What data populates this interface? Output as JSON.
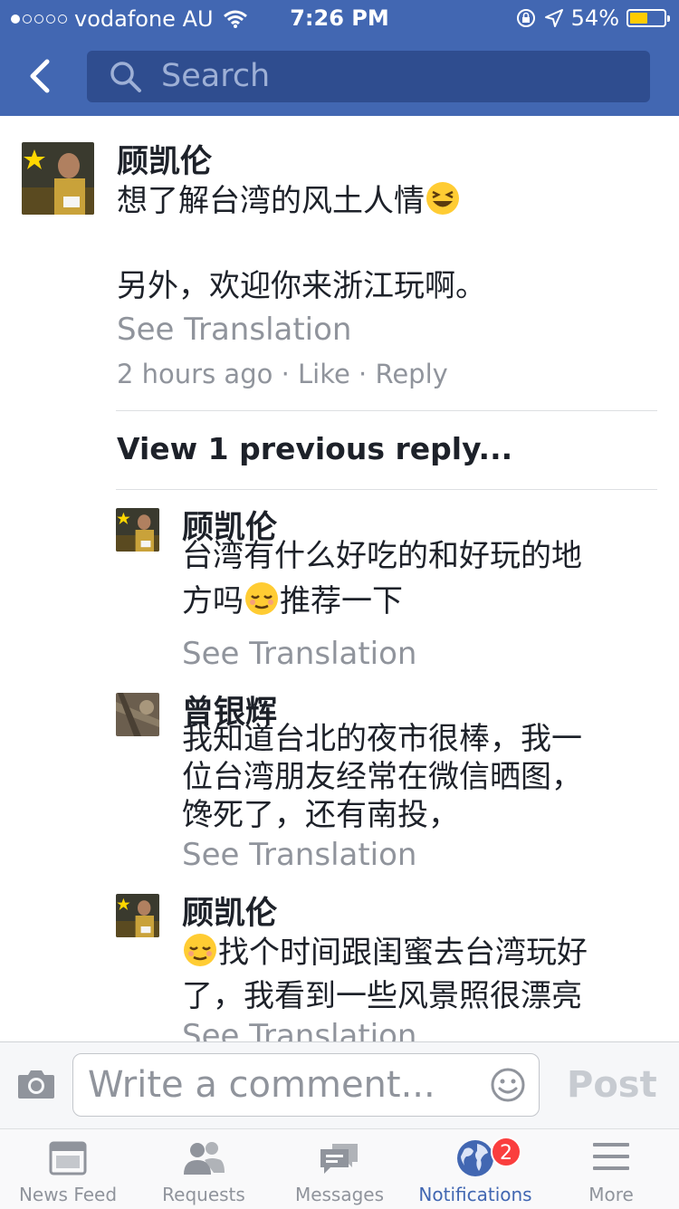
{
  "status": {
    "carrier": "vodafone AU",
    "time": "7:26 PM",
    "battery": "54%",
    "battery_level": 0.54
  },
  "nav": {
    "search_placeholder": "Search"
  },
  "comment": {
    "author": "顾凯伦",
    "line1": "想了解台湾的风土人情",
    "line2": "另外，欢迎你来浙江玩啊。",
    "see_translation": "See Translation",
    "time": "2 hours ago",
    "like": "Like",
    "reply": "Reply",
    "sep": "·"
  },
  "view_previous": "View 1 previous reply...",
  "replies": [
    {
      "author": "顾凯伦",
      "line1": "台湾有什么好吃的和好玩的地",
      "line2_pre": "方吗",
      "line2_post": "推荐一下",
      "see_translation": "See Translation"
    },
    {
      "author": "曾银辉",
      "line1": "我知道台北的夜市很棒，我一",
      "line2": "位台湾朋友经常在微信晒图，",
      "line3": "馋死了，还有南投，",
      "see_translation": "See Translation"
    },
    {
      "author": "顾凯伦",
      "line1": "找个时间跟闺蜜去台湾玩好",
      "line2": "了，我看到一些风景照很漂亮",
      "see_translation": "See Translation"
    }
  ],
  "composer": {
    "placeholder": "Write a comment...",
    "post_label": "Post"
  },
  "tabs": [
    {
      "label": "News Feed",
      "icon": "news-feed-icon"
    },
    {
      "label": "Requests",
      "icon": "friend-requests-icon"
    },
    {
      "label": "Messages",
      "icon": "messages-icon"
    },
    {
      "label": "Notifications",
      "icon": "globe-icon",
      "badge": "2",
      "active": true
    },
    {
      "label": "More",
      "icon": "hamburger-icon"
    }
  ],
  "colors": {
    "brand": "#4267b2",
    "muted": "#90949c",
    "badge": "#fa3e3e"
  }
}
